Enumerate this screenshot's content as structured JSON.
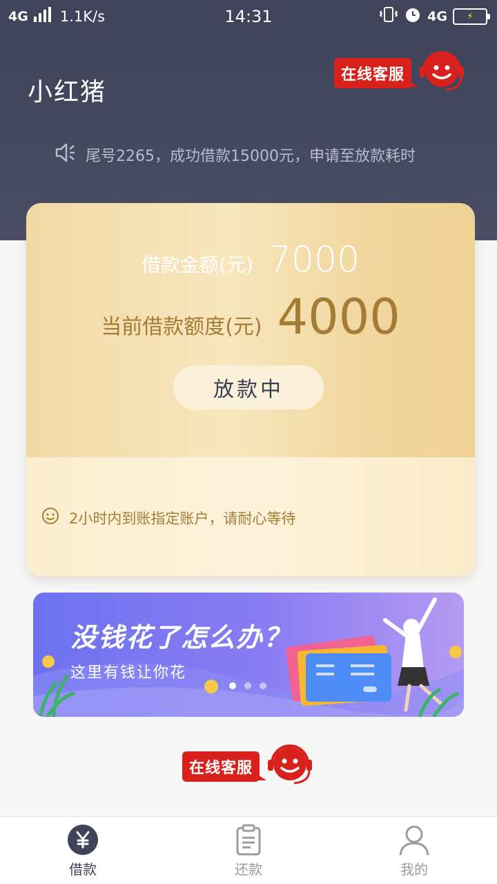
{
  "status_bar": {
    "network": "4G",
    "speed": "1.1K/s",
    "time": "14:31",
    "network_right": "4G"
  },
  "header": {
    "app_title": "小红猪",
    "customer_service_label": "在线客服",
    "notice_text": "尾号2265，成功借款15000元，申请至放款耗时"
  },
  "loan_card": {
    "amount_label": "借款金额(元)",
    "amount_value": "7000",
    "limit_label": "当前借款额度(元)",
    "limit_value": "4000",
    "status_button_label": "放款中",
    "tip_text": "2小时内到账指定账户，请耐心等待"
  },
  "banner": {
    "title": "没钱花了怎么办？",
    "subtitle": "这里有钱让你花",
    "slide_count": 3,
    "active_slide": 1
  },
  "footer": {
    "customer_service_label": "在线客服"
  },
  "bottom_nav": {
    "items": [
      {
        "label": "借款",
        "icon": "yuan-icon",
        "active": true
      },
      {
        "label": "还款",
        "icon": "clipboard-icon",
        "active": false
      },
      {
        "label": "我的",
        "icon": "user-icon",
        "active": false
      }
    ]
  },
  "colors": {
    "header_bg": "#40435a",
    "accent_gold": "#a57c36",
    "cs_red": "#d8201c",
    "banner_purple": "#7a76f1"
  }
}
